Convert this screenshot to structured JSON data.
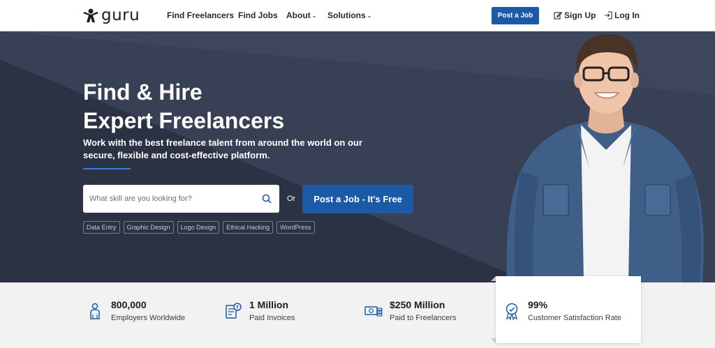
{
  "brand": {
    "name": "guru"
  },
  "nav": {
    "links": [
      {
        "label": "Find Freelancers"
      },
      {
        "label": "Find Jobs"
      },
      {
        "label": "About"
      },
      {
        "label": "Solutions"
      }
    ],
    "post_job_label": "Post a Job",
    "sign_up_label": "Sign Up",
    "log_in_label": "Log In"
  },
  "hero": {
    "title_line1": "Find & Hire",
    "title_line2": "Expert Freelancers",
    "subtitle": "Work with the best freelance talent from around the world on our secure, flexible and cost-effective platform.",
    "search_placeholder": "What skill are you looking for?",
    "or_text": "Or",
    "cta_label": "Post a Job - It's Free",
    "tags": [
      "Data Entry",
      "Graphic Design",
      "Logo Design",
      "Ethical Hacking",
      "WordPress"
    ]
  },
  "stats": [
    {
      "value": "800,000",
      "label": "Employers Worldwide",
      "icon": "employers-icon"
    },
    {
      "value": "1 Million",
      "label": "Paid Invoices",
      "icon": "invoice-icon"
    },
    {
      "value": "$250 Million",
      "label": "Paid to Freelancers",
      "icon": "money-icon"
    },
    {
      "value": "99%",
      "label": "Customer Satisfaction Rate",
      "icon": "award-icon"
    }
  ],
  "colors": {
    "primary": "#1a5aa6",
    "hero_bg": "#2e3546",
    "stats_bg": "#f2f2f2"
  }
}
